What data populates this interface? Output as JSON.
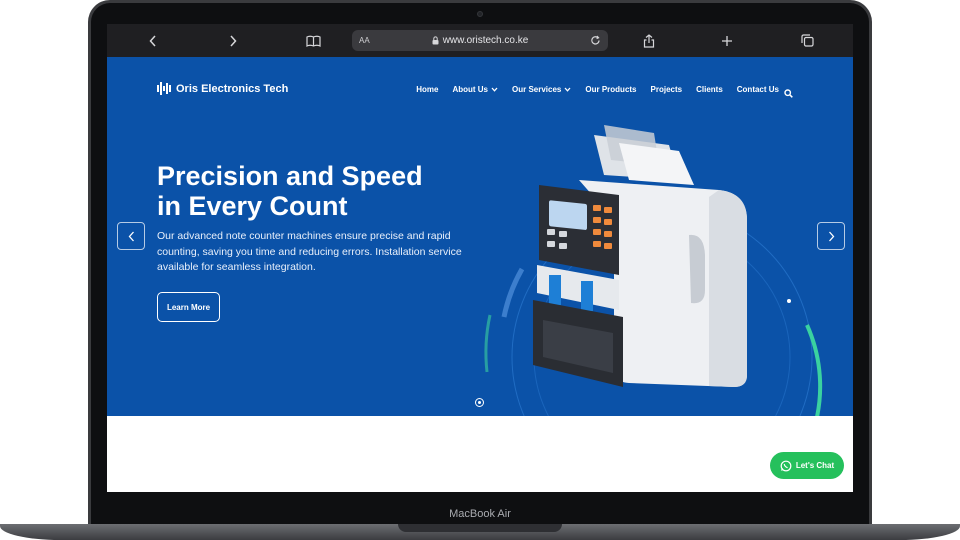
{
  "device": {
    "label": "MacBook Air"
  },
  "browser": {
    "text_size_label": "AA",
    "url": "www.oristech.co.ke",
    "icons": [
      "back-icon",
      "forward-icon",
      "book-icon",
      "lock-icon",
      "reload-icon",
      "share-icon",
      "plus-icon",
      "tabs-icon"
    ]
  },
  "site": {
    "logo_text": "Oris Electronics Tech",
    "nav": [
      {
        "label": "Home",
        "has_dropdown": false
      },
      {
        "label": "About Us",
        "has_dropdown": true
      },
      {
        "label": "Our Services",
        "has_dropdown": true
      },
      {
        "label": "Our Products",
        "has_dropdown": false
      },
      {
        "label": "Projects",
        "has_dropdown": false
      },
      {
        "label": "Clients",
        "has_dropdown": false
      },
      {
        "label": "Contact Us",
        "has_dropdown": false
      }
    ]
  },
  "hero": {
    "headline_line1": "Precision and Speed",
    "headline_line2": "in Every Count",
    "subtext": "Our advanced note counter machines ensure precise and rapid counting, saving you time and reducing errors. Installation service available for seamless integration.",
    "cta_label": "Learn More",
    "slide_count": 1,
    "active_slide": 1
  },
  "chat": {
    "label": "Let's Chat"
  },
  "colors": {
    "hero_bg": "#0b52a8",
    "chat_green": "#25c05c",
    "browser_chrome": "#1f1f22",
    "accent_ring": "#3ad2a0"
  }
}
